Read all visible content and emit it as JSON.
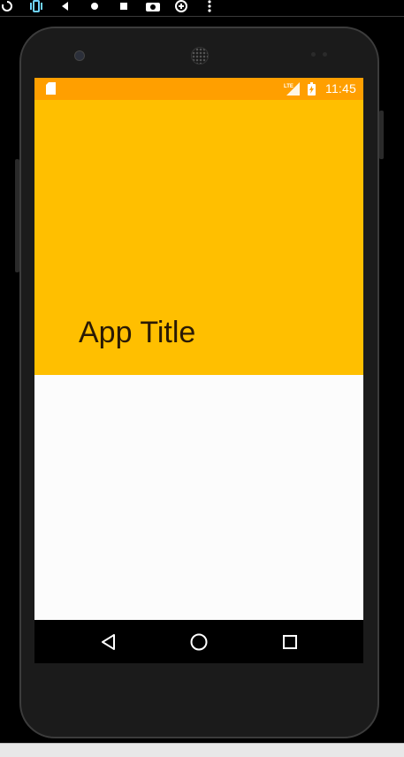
{
  "emulator_toolbar": {
    "icons": [
      "rotate-left-icon",
      "rotate-right-icon",
      "back-triangle-icon",
      "home-dot-icon",
      "overview-square-icon",
      "camera-icon",
      "zoom-icon",
      "more-vert-icon"
    ]
  },
  "device": {
    "status_bar": {
      "time": "11:45",
      "network_label": "LTE",
      "color": "#ff9f00"
    },
    "app": {
      "title": "App Title",
      "appbar_color": "#ffbf00",
      "content_color": "#fcfcfc"
    },
    "nav_bar": {
      "buttons": [
        "back-icon",
        "home-icon",
        "recents-icon"
      ]
    }
  }
}
